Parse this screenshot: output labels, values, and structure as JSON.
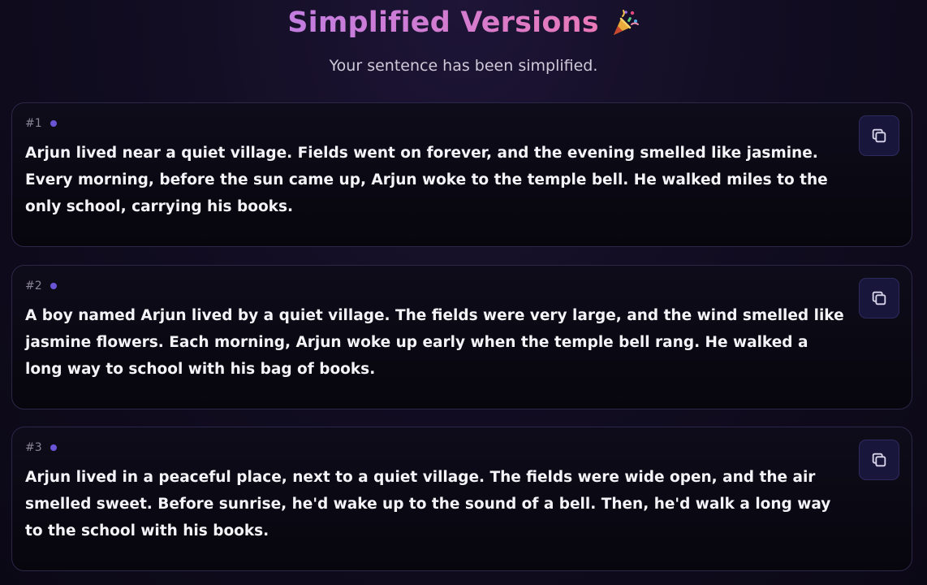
{
  "header": {
    "title": "Simplified Versions",
    "subtitle": "Your sentence has been simplified."
  },
  "icons": {
    "title_icon": "party-popper-icon",
    "copy_icon": "copy-icon"
  },
  "colors": {
    "title_gradient_start": "#c17ddf",
    "title_gradient_end": "#ea78b8",
    "dot": "#6b55d6",
    "copy_button_bg": "#19163c"
  },
  "results": [
    {
      "index": "#1",
      "text": "Arjun lived near a quiet village. Fields went on forever, and the evening smelled like jasmine. Every morning, before the sun came up, Arjun woke to the temple bell. He walked miles to the only school, carrying his books."
    },
    {
      "index": "#2",
      "text": "A boy named Arjun lived by a quiet village. The fields were very large, and the wind smelled like jasmine flowers. Each morning, Arjun woke up early when the temple bell rang. He walked a long way to school with his bag of books."
    },
    {
      "index": "#3",
      "text": "Arjun lived in a peaceful place, next to a quiet village. The fields were wide open, and the air smelled sweet. Before sunrise, he'd wake up to the sound of a bell. Then, he'd walk a long way to the school with his books."
    }
  ]
}
